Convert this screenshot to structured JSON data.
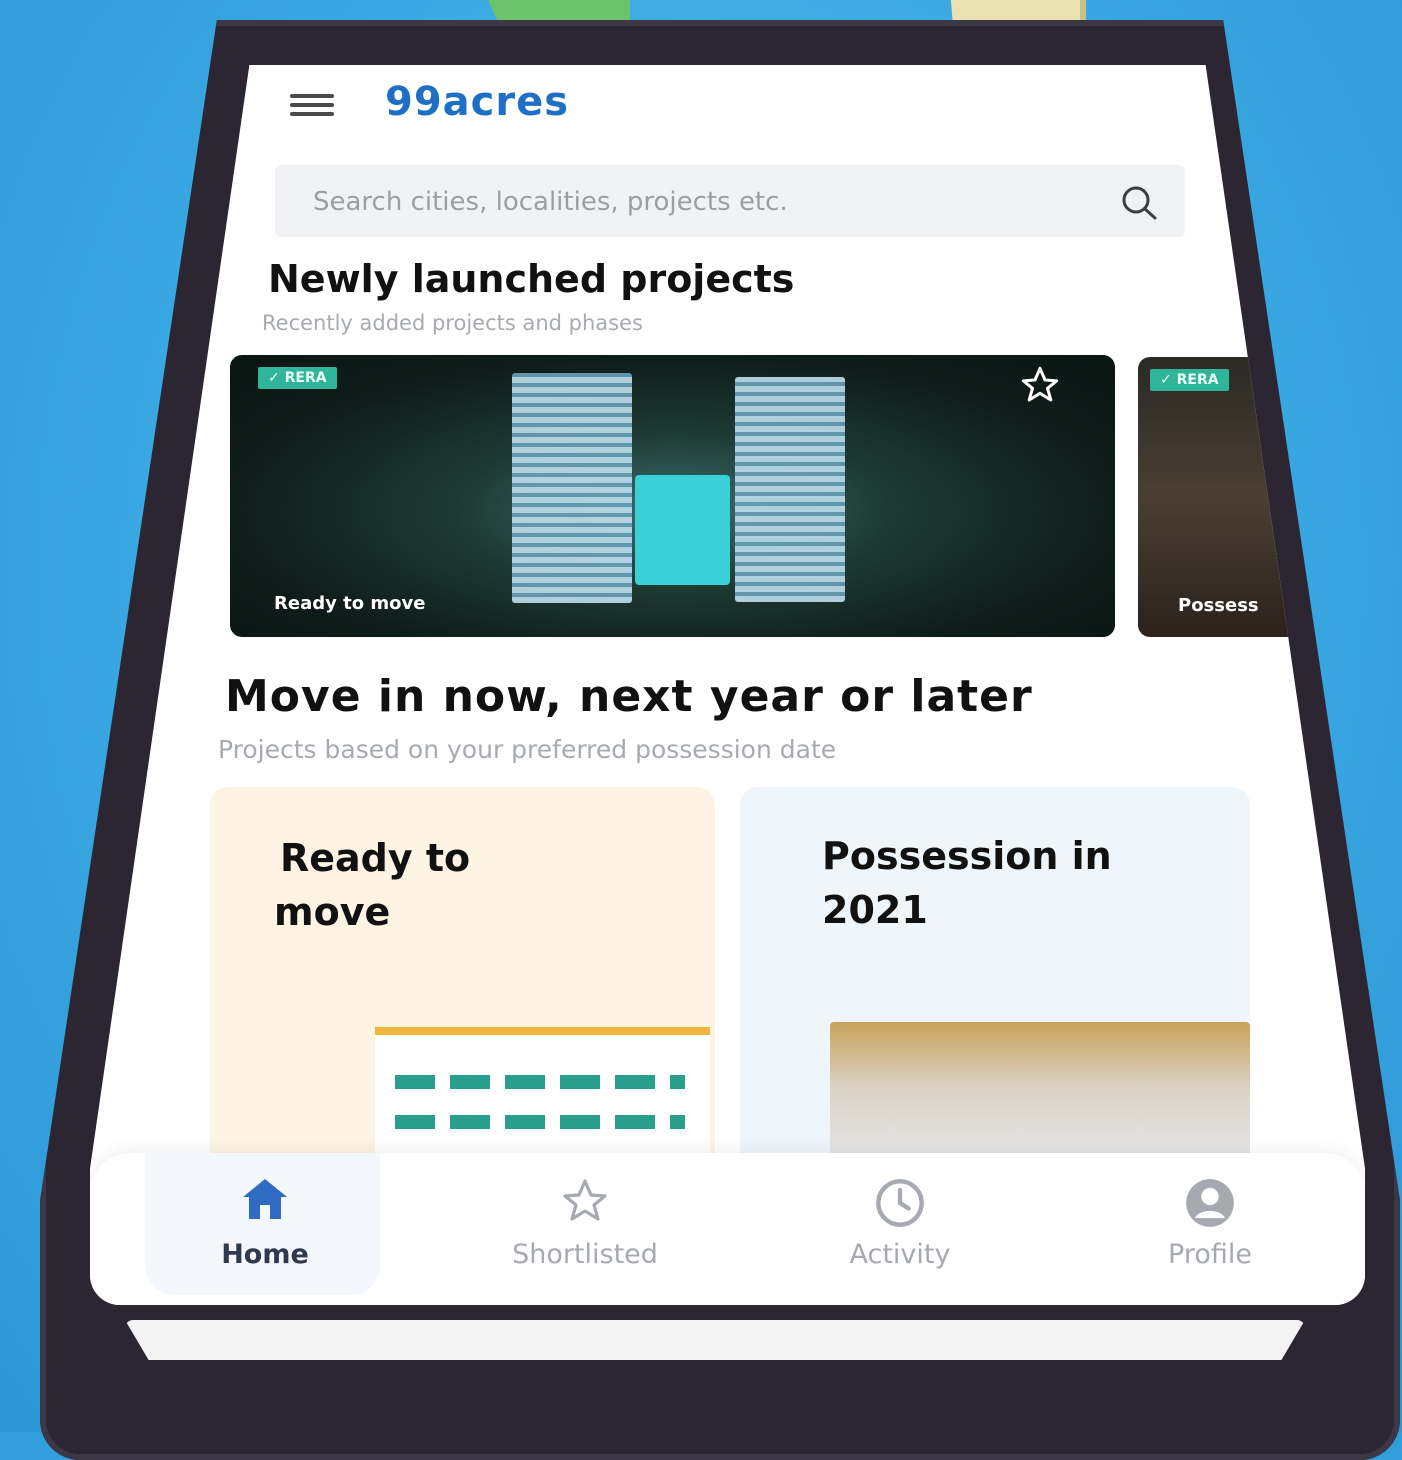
{
  "app": {
    "brand": "99acres"
  },
  "search": {
    "placeholder": "Search cities, localities, projects etc."
  },
  "new_projects": {
    "title": "Newly launched projects",
    "subtitle": "Recently added projects and phases",
    "cards": [
      {
        "badge": "✓ RERA",
        "status": "Ready to move"
      },
      {
        "badge": "✓ RERA",
        "status": "Possess"
      }
    ]
  },
  "possession": {
    "title": "Move in now, next year or later",
    "subtitle": "Projects based on your preferred possession date",
    "tiles": [
      {
        "line1": "Ready to",
        "line2": "move",
        "bg": "#fdf4e3"
      },
      {
        "line1": "Possession in",
        "line2": "2021",
        "bg": "#eef5fb"
      }
    ]
  },
  "bottom_nav": {
    "items": [
      {
        "label": "Home",
        "active": true,
        "icon": "home-icon"
      },
      {
        "label": "Shortlisted",
        "active": false,
        "icon": "star-icon"
      },
      {
        "label": "Activity",
        "active": false,
        "icon": "clock-icon"
      },
      {
        "label": "Profile",
        "active": false,
        "icon": "profile-icon"
      }
    ]
  },
  "colors": {
    "brand": "#1f6fc5",
    "rera": "#2fb59a",
    "accent_blue": "#2f6bc2",
    "background": "#3aa8e2"
  }
}
